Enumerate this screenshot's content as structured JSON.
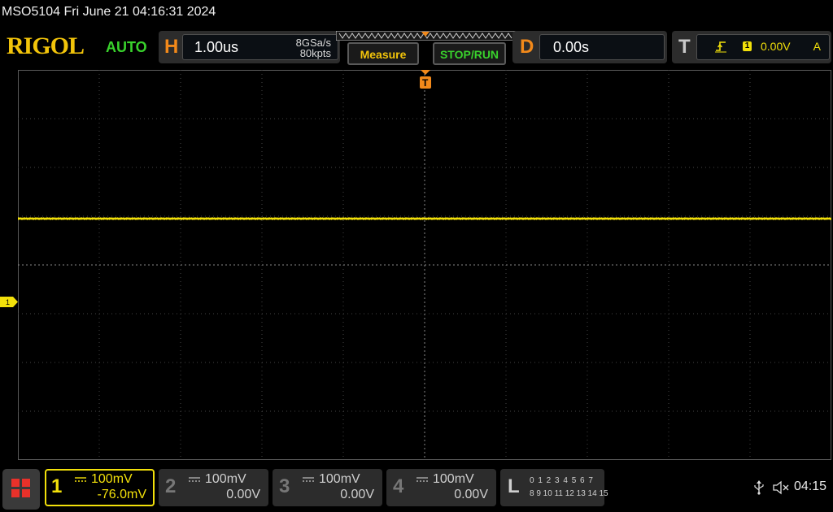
{
  "titlebar": {
    "title": "MSO5104  Fri June 21 04:16:31 2024"
  },
  "brand": {
    "logo": "RIGOL",
    "mode": "AUTO"
  },
  "horizontal": {
    "letter": "H",
    "scale": "1.00us",
    "sample_rate": "8GSa/s",
    "memory_depth": "80kpts"
  },
  "buttons": {
    "measure": "Measure",
    "stop_run": "STOP/RUN"
  },
  "delay": {
    "letter": "D",
    "value": "0.00s"
  },
  "trigger": {
    "letter": "T",
    "channel": "1",
    "level": "0.00V",
    "source": "A",
    "slope_icon": "rising-edge-icon"
  },
  "screen": {
    "ch1_marker": "1",
    "trigger_marker": "T"
  },
  "channels": [
    {
      "num": "1",
      "scale": "100mV",
      "offset": "-76.0mV",
      "active": true
    },
    {
      "num": "2",
      "scale": "100mV",
      "offset": "0.00V",
      "active": false
    },
    {
      "num": "3",
      "scale": "100mV",
      "offset": "0.00V",
      "active": false
    },
    {
      "num": "4",
      "scale": "100mV",
      "offset": "0.00V",
      "active": false
    }
  ],
  "logic": {
    "letter": "L",
    "row1": "0 1 2 3   4 5 6 7",
    "row2": "8  9 10 11  12 13 14 15"
  },
  "status": {
    "clock": "04:15",
    "usb_icon": "usb-icon",
    "mute_icon": "speaker-muted-icon"
  },
  "colors": {
    "ch1": "#f2e00a",
    "trigger": "#f2891a",
    "run": "#39d22c",
    "brand": "#f2c40a"
  }
}
